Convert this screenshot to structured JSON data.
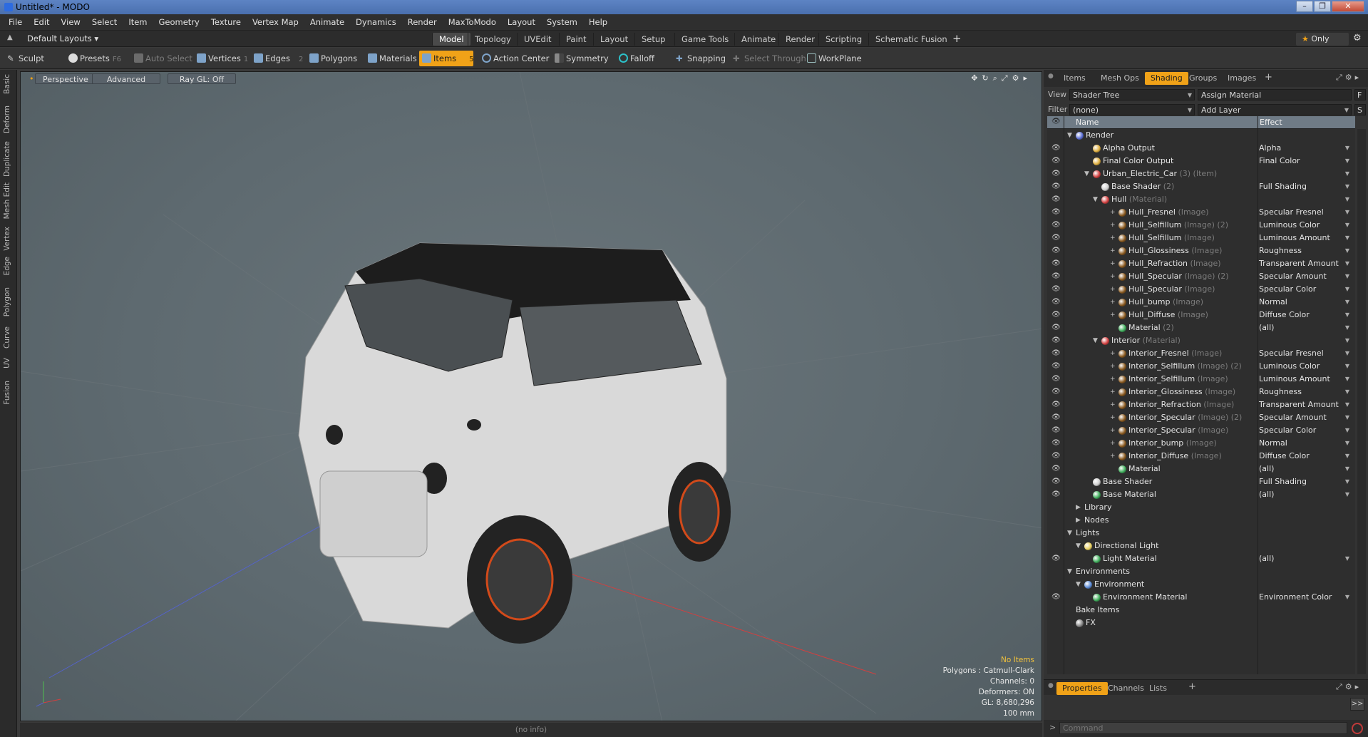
{
  "window": {
    "title": "Untitled* - MODO"
  },
  "menu": [
    "File",
    "Edit",
    "View",
    "Select",
    "Item",
    "Geometry",
    "Texture",
    "Vertex Map",
    "Animate",
    "Dynamics",
    "Render",
    "MaxToModo",
    "Layout",
    "System",
    "Help"
  ],
  "layouts": {
    "selector": "Default Layouts ▾",
    "tabs": [
      "Model",
      "Topology",
      "UVEdit",
      "Paint",
      "Layout",
      "Setup",
      "Game Tools",
      "Animate",
      "Render",
      "Scripting",
      "Schematic Fusion"
    ],
    "active": "Model",
    "add": "+",
    "only": "Only"
  },
  "toolbar": {
    "sculpt": "Sculpt",
    "presets": "Presets",
    "presets_key": "F6",
    "auto_select": "Auto Select",
    "vertices": "Vertices",
    "vertices_key": "1",
    "edges": "Edges",
    "edges_key": "2",
    "polygons": "Polygons",
    "materials": "Materials",
    "items": "Items",
    "items_key": "5",
    "action_center": "Action Center",
    "symmetry": "Symmetry",
    "falloff": "Falloff",
    "snapping": "Snapping",
    "select_through": "Select Through",
    "workplane": "WorkPlane"
  },
  "left_tabs": [
    "Basic",
    "Deform",
    "Duplicate",
    "Mesh Edit",
    "Vertex",
    "Edge",
    "Polygon",
    "Curve",
    "UV",
    "Fusion"
  ],
  "viewport": {
    "perspective": "Perspective",
    "advanced": "Advanced",
    "raygl": "Ray GL: Off",
    "info": {
      "items": "No Items",
      "polygons": "Polygons : Catmull-Clark",
      "channels": "Channels: 0",
      "deformers": "Deformers: ON",
      "gl": "GL: 8,680,296",
      "scale": "100 mm"
    }
  },
  "status": "(no info)",
  "panel": {
    "tabs": [
      "Items",
      "Mesh Ops",
      "Shading",
      "Groups",
      "Images"
    ],
    "active_tab": "Shading",
    "add": "+",
    "view_label": "View",
    "view_value": "Shader Tree",
    "assign_material": "Assign Material",
    "f_btn": "F",
    "filter_label": "Filter",
    "filter_value": "(none)",
    "add_layer": "Add Layer",
    "s_btn": "S",
    "col_name": "Name",
    "col_effect": "Effect"
  },
  "tree": [
    {
      "name": "Render",
      "sub": "",
      "effect": "",
      "lvl": 0,
      "exp": "▼",
      "icon": "#5c6fd6",
      "eye": false
    },
    {
      "name": "Alpha Output",
      "sub": "",
      "effect": "Alpha",
      "lvl": 2,
      "exp": "",
      "icon": "#e0b040",
      "eye": true
    },
    {
      "name": "Final Color Output",
      "sub": "",
      "effect": "Final Color",
      "lvl": 2,
      "exp": "",
      "icon": "#e0b040",
      "eye": true
    },
    {
      "name": "Urban_Electric_Car",
      "sub": " (3) (Item)",
      "effect": "",
      "lvl": 2,
      "exp": "▼",
      "icon": "#d34040",
      "eye": true
    },
    {
      "name": "Base Shader",
      "sub": " (2)",
      "effect": "Full Shading",
      "lvl": 3,
      "exp": "",
      "icon": "#cfcfcf",
      "eye": true
    },
    {
      "name": "Hull",
      "sub": " (Material)",
      "effect": "",
      "lvl": 3,
      "exp": "▼",
      "icon": "#d34040",
      "eye": true
    },
    {
      "name": "Hull_Fresnel",
      "sub": " (Image)",
      "effect": "Specular Fresnel",
      "lvl": 5,
      "exp": "+",
      "icon": "#8a5a20",
      "eye": true
    },
    {
      "name": "Hull_Selfillum",
      "sub": " (Image) (2)",
      "effect": "Luminous Color",
      "lvl": 5,
      "exp": "+",
      "icon": "#8a5a20",
      "eye": true
    },
    {
      "name": "Hull_Selfillum",
      "sub": " (Image)",
      "effect": "Luminous Amount",
      "lvl": 5,
      "exp": "+",
      "icon": "#8a5a20",
      "eye": true
    },
    {
      "name": "Hull_Glossiness",
      "sub": " (Image)",
      "effect": "Roughness",
      "lvl": 5,
      "exp": "+",
      "icon": "#8a5a20",
      "eye": true
    },
    {
      "name": "Hull_Refraction",
      "sub": " (Image)",
      "effect": "Transparent Amount",
      "lvl": 5,
      "exp": "+",
      "icon": "#8a5a20",
      "eye": true
    },
    {
      "name": "Hull_Specular",
      "sub": " (Image) (2)",
      "effect": "Specular Amount",
      "lvl": 5,
      "exp": "+",
      "icon": "#8a5a20",
      "eye": true
    },
    {
      "name": "Hull_Specular",
      "sub": " (Image)",
      "effect": "Specular Color",
      "lvl": 5,
      "exp": "+",
      "icon": "#8a5a20",
      "eye": true
    },
    {
      "name": "Hull_bump",
      "sub": " (Image)",
      "effect": "Normal",
      "lvl": 5,
      "exp": "+",
      "icon": "#8a5a20",
      "eye": true
    },
    {
      "name": "Hull_Diffuse",
      "sub": " (Image)",
      "effect": "Diffuse Color",
      "lvl": 5,
      "exp": "+",
      "icon": "#8a5a20",
      "eye": true
    },
    {
      "name": "Material",
      "sub": " (2)",
      "effect": "(all)",
      "lvl": 5,
      "exp": "",
      "icon": "#3fae5b",
      "eye": true
    },
    {
      "name": "Interior",
      "sub": " (Material)",
      "effect": "",
      "lvl": 3,
      "exp": "▼",
      "icon": "#d34040",
      "eye": true
    },
    {
      "name": "Interior_Fresnel",
      "sub": " (Image)",
      "effect": "Specular Fresnel",
      "lvl": 5,
      "exp": "+",
      "icon": "#8a5a20",
      "eye": true
    },
    {
      "name": "Interior_Selfillum",
      "sub": " (Image) (2)",
      "effect": "Luminous Color",
      "lvl": 5,
      "exp": "+",
      "icon": "#8a5a20",
      "eye": true
    },
    {
      "name": "Interior_Selfillum",
      "sub": " (Image)",
      "effect": "Luminous Amount",
      "lvl": 5,
      "exp": "+",
      "icon": "#8a5a20",
      "eye": true
    },
    {
      "name": "Interior_Glossiness",
      "sub": " (Image)",
      "effect": "Roughness",
      "lvl": 5,
      "exp": "+",
      "icon": "#8a5a20",
      "eye": true
    },
    {
      "name": "Interior_Refraction",
      "sub": " (Image)",
      "effect": "Transparent Amount",
      "lvl": 5,
      "exp": "+",
      "icon": "#8a5a20",
      "eye": true
    },
    {
      "name": "Interior_Specular",
      "sub": " (Image) (2)",
      "effect": "Specular Amount",
      "lvl": 5,
      "exp": "+",
      "icon": "#8a5a20",
      "eye": true
    },
    {
      "name": "Interior_Specular",
      "sub": " (Image)",
      "effect": "Specular Color",
      "lvl": 5,
      "exp": "+",
      "icon": "#8a5a20",
      "eye": true
    },
    {
      "name": "Interior_bump",
      "sub": " (Image)",
      "effect": "Normal",
      "lvl": 5,
      "exp": "+",
      "icon": "#8a5a20",
      "eye": true
    },
    {
      "name": "Interior_Diffuse",
      "sub": " (Image)",
      "effect": "Diffuse Color",
      "lvl": 5,
      "exp": "+",
      "icon": "#8a5a20",
      "eye": true
    },
    {
      "name": "Material",
      "sub": "",
      "effect": "(all)",
      "lvl": 5,
      "exp": "",
      "icon": "#3fae5b",
      "eye": true
    },
    {
      "name": "Base Shader",
      "sub": "",
      "effect": "Full Shading",
      "lvl": 2,
      "exp": "",
      "icon": "#cfcfcf",
      "eye": true
    },
    {
      "name": "Base Material",
      "sub": "",
      "effect": "(all)",
      "lvl": 2,
      "exp": "",
      "icon": "#3fae5b",
      "eye": true
    },
    {
      "name": "Library",
      "sub": "",
      "effect": "",
      "lvl": 1,
      "exp": "▶",
      "icon": "",
      "eye": false
    },
    {
      "name": "Nodes",
      "sub": "",
      "effect": "",
      "lvl": 1,
      "exp": "▶",
      "icon": "",
      "eye": false
    },
    {
      "name": "Lights",
      "sub": "",
      "effect": "",
      "lvl": 0,
      "exp": "▼",
      "icon": "",
      "eye": false
    },
    {
      "name": "Directional Light",
      "sub": "",
      "effect": "",
      "lvl": 1,
      "exp": "▼",
      "icon": "#e8d060",
      "eye": false
    },
    {
      "name": "Light Material",
      "sub": "",
      "effect": "(all)",
      "lvl": 2,
      "exp": "",
      "icon": "#3fae5b",
      "eye": true
    },
    {
      "name": "Environments",
      "sub": "",
      "effect": "",
      "lvl": 0,
      "exp": "▼",
      "icon": "",
      "eye": false
    },
    {
      "name": "Environment",
      "sub": "",
      "effect": "",
      "lvl": 1,
      "exp": "▼",
      "icon": "#5a8ad6",
      "eye": false
    },
    {
      "name": "Environment Material",
      "sub": "",
      "effect": "Environment Color",
      "lvl": 2,
      "exp": "",
      "icon": "#3fae5b",
      "eye": true
    },
    {
      "name": "Bake Items",
      "sub": "",
      "effect": "",
      "lvl": 0,
      "exp": "",
      "icon": "",
      "eye": false
    },
    {
      "name": "FX",
      "sub": "",
      "effect": "",
      "lvl": 0,
      "exp": "",
      "icon": "#888888",
      "eye": false
    }
  ],
  "bottom_tabs": [
    "Properties",
    "Channels",
    "Lists"
  ],
  "bottom_active": "Properties",
  "bottom_add": "+",
  "command_placeholder": "Command",
  "colors": {
    "accent": "#f0a218",
    "viewport_bg": "#5e6a70",
    "warn": "#f2c23b"
  }
}
